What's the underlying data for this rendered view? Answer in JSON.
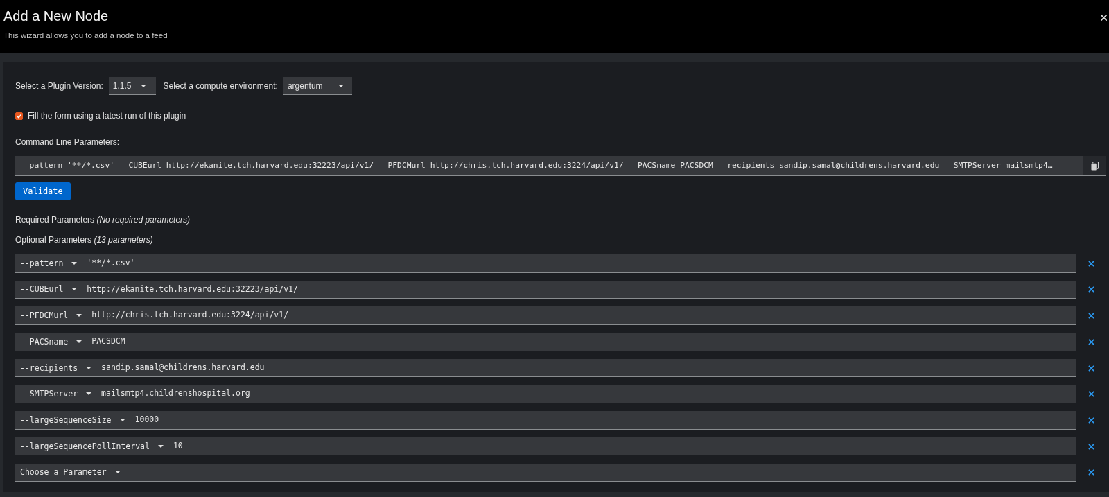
{
  "header": {
    "title": "Add a New Node",
    "subtitle": "This wizard allows you to add a node to a feed"
  },
  "plugin_version": {
    "label": "Select a Plugin Version:",
    "value": "1.1.5"
  },
  "compute_environment": {
    "label": "Select a compute environment:",
    "value": "argentum"
  },
  "fill_form_checkbox": {
    "label": "Fill the form using a latest run of this plugin",
    "checked": true
  },
  "command_line": {
    "label": "Command Line Parameters:",
    "value": "--pattern '**/*.csv' --CUBEurl http://ekanite.tch.harvard.edu:32223/api/v1/ --PFDCMurl http://chris.tch.harvard.edu:3224/api/v1/ --PACSname PACSDCM --recipients sandip.samal@childrens.harvard.edu --SMTPServer mailsmtp4…"
  },
  "validate_button": "Validate",
  "required_parameters": "Required Parameters *(No required parameters)*",
  "optional_parameters": "Optional Parameters *(13 parameters)*",
  "parameters": [
    {
      "flag": "--pattern",
      "value": "'**/*.csv'"
    },
    {
      "flag": "--CUBEurl",
      "value": "http://ekanite.tch.harvard.edu:32223/api/v1/"
    },
    {
      "flag": "--PFDCMurl",
      "value": "http://chris.tch.harvard.edu:3224/api/v1/"
    },
    {
      "flag": "--PACSname",
      "value": "PACSDCM"
    },
    {
      "flag": "--recipients",
      "value": "sandip.samal@childrens.harvard.edu"
    },
    {
      "flag": "--SMTPServer",
      "value": "mailsmtp4.childrenshospital.org"
    },
    {
      "flag": "--largeSequenceSize",
      "value": "10000"
    },
    {
      "flag": "--largeSequencePollInterval",
      "value": "10"
    }
  ],
  "new_parameter": {
    "label": "Choose a Parameter"
  }
}
